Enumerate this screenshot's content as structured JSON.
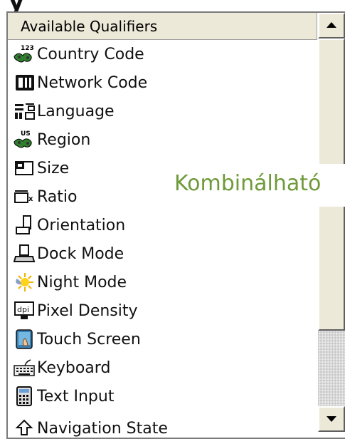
{
  "top_partial_text": "y",
  "list": {
    "header": "Available Qualifiers",
    "items": [
      {
        "label": "Country Code",
        "icon": "country-code-icon"
      },
      {
        "label": "Network Code",
        "icon": "network-code-icon"
      },
      {
        "label": "Language",
        "icon": "language-icon"
      },
      {
        "label": "Region",
        "icon": "region-icon"
      },
      {
        "label": "Size",
        "icon": "size-icon"
      },
      {
        "label": "Ratio",
        "icon": "ratio-icon"
      },
      {
        "label": "Orientation",
        "icon": "orientation-icon"
      },
      {
        "label": "Dock Mode",
        "icon": "dock-mode-icon"
      },
      {
        "label": "Night Mode",
        "icon": "night-mode-icon"
      },
      {
        "label": "Pixel Density",
        "icon": "pixel-density-icon"
      },
      {
        "label": "Touch Screen",
        "icon": "touch-screen-icon"
      },
      {
        "label": "Keyboard",
        "icon": "keyboard-icon"
      },
      {
        "label": "Text Input",
        "icon": "text-input-icon"
      },
      {
        "label": "Navigation State",
        "icon": "navigation-state-icon"
      }
    ]
  },
  "overlay": {
    "text": "Kombinálható",
    "color": "#6f9a3a"
  },
  "scrollbar": {
    "up_icon": "scroll-up-arrow-icon",
    "down_icon": "scroll-down-arrow-icon"
  }
}
